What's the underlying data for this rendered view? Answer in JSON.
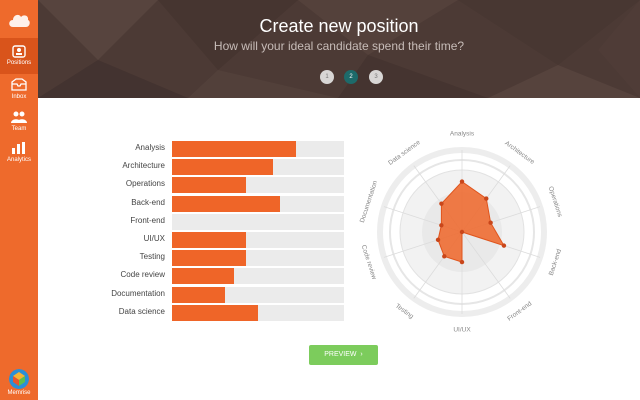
{
  "sidebar": {
    "items": [
      {
        "label": "Positions",
        "icon": "positions-icon",
        "active": true
      },
      {
        "label": "Inbox",
        "icon": "inbox-icon",
        "active": false
      },
      {
        "label": "Team",
        "icon": "team-icon",
        "active": false
      },
      {
        "label": "Analytics",
        "icon": "analytics-icon",
        "active": false
      }
    ],
    "account_label": "Memrise"
  },
  "header": {
    "title": "Create new position",
    "subtitle": "How will your ideal candidate spend their time?",
    "steps": [
      {
        "label": "1",
        "active": false
      },
      {
        "label": "2",
        "active": true
      },
      {
        "label": "3",
        "active": false
      }
    ]
  },
  "skills": [
    {
      "label": "Analysis",
      "value": 72
    },
    {
      "label": "Architecture",
      "value": 59
    },
    {
      "label": "Operations",
      "value": 43
    },
    {
      "label": "Back-end",
      "value": 63
    },
    {
      "label": "Front-end",
      "value": 0
    },
    {
      "label": "UI/UX",
      "value": 43
    },
    {
      "label": "Testing",
      "value": 43
    },
    {
      "label": "Code review",
      "value": 36
    },
    {
      "label": "Documentation",
      "value": 31
    },
    {
      "label": "Data science",
      "value": 50
    }
  ],
  "preview_label": "PREVIEW",
  "colors": {
    "accent": "#ef6528",
    "header": "#4c3a35",
    "step_active": "#1d6a6a",
    "preview": "#7ccc5c"
  }
}
